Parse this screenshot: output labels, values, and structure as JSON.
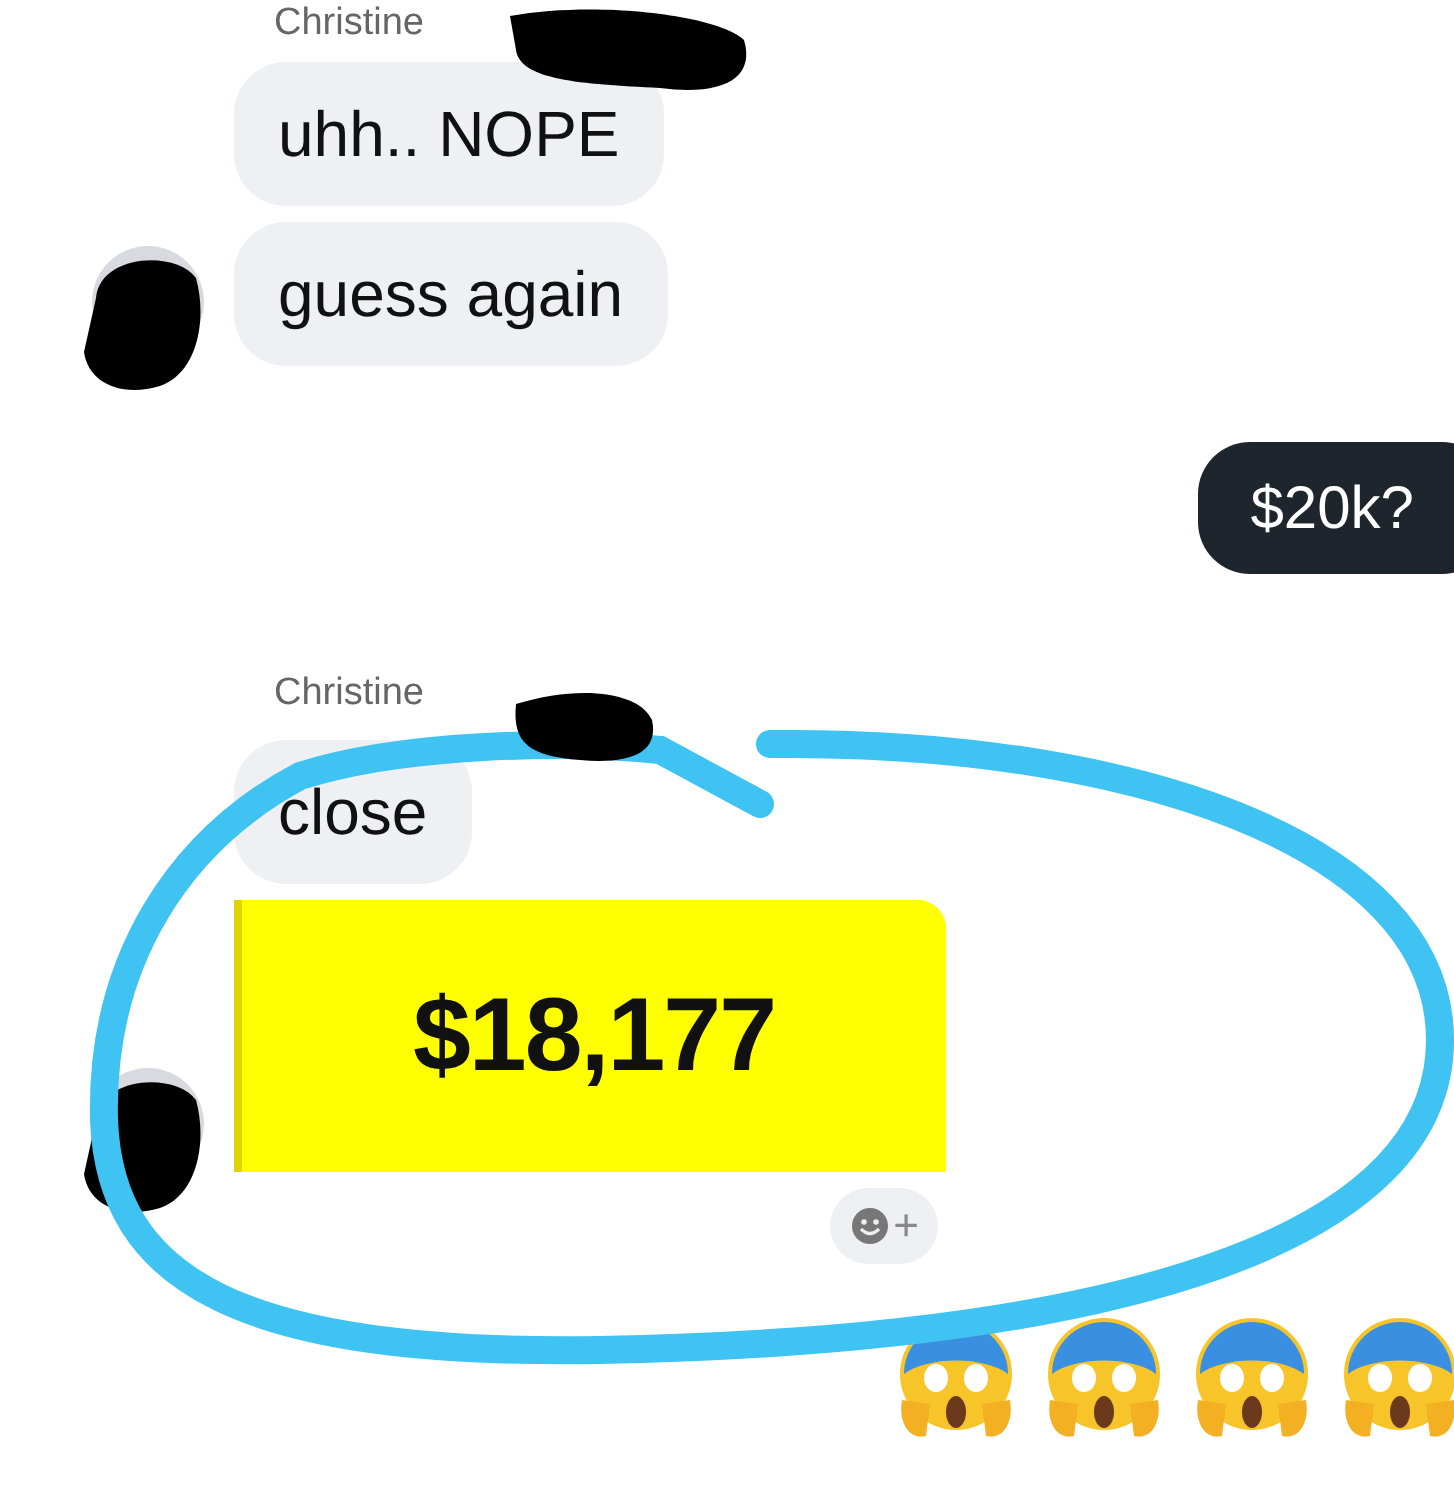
{
  "messages": [
    {
      "kind": "sender",
      "text": "Christine"
    },
    {
      "kind": "incoming",
      "text": "uhh.. NOPE"
    },
    {
      "kind": "incoming",
      "text": "guess again",
      "avatar": true
    },
    {
      "kind": "outgoing",
      "text": "$20k?"
    },
    {
      "kind": "sender",
      "text": "Christine"
    },
    {
      "kind": "incoming",
      "text": "close"
    },
    {
      "kind": "highlight",
      "text": "$18,177",
      "avatar": true
    },
    {
      "kind": "reaction_button",
      "text": "+"
    },
    {
      "kind": "emoji_row",
      "emojis": [
        {
          "kind": "scream"
        },
        {
          "kind": "scream"
        },
        {
          "kind": "scream"
        },
        {
          "kind": "scream"
        }
      ]
    }
  ]
}
